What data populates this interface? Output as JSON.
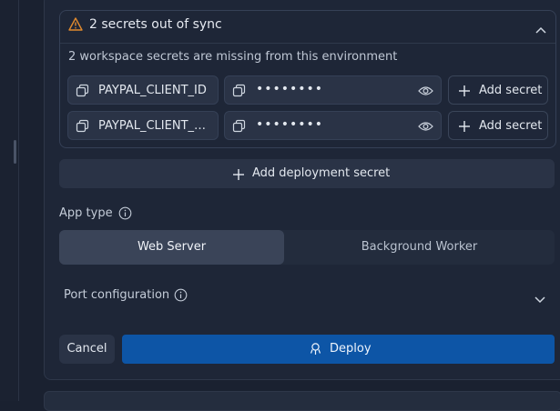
{
  "sync_warning": {
    "title": "2 secrets out of sync",
    "description": "2 workspace secrets are missing from this environment",
    "rows": [
      {
        "name": "PAYPAL_CLIENT_ID",
        "masked_value": "••••••••",
        "add_label": "Add secret"
      },
      {
        "name": "PAYPAL_CLIENT_…",
        "masked_value": "••••••••",
        "add_label": "Add secret"
      }
    ]
  },
  "add_deployment_secret_label": "Add deployment secret",
  "app_type": {
    "label": "App type",
    "options": [
      "Web Server",
      "Background Worker"
    ],
    "selected": "Web Server"
  },
  "port_configuration": {
    "label": "Port configuration"
  },
  "actions": {
    "cancel": "Cancel",
    "deploy": "Deploy"
  },
  "colors": {
    "accent": "#0d55a6",
    "warning": "#e08a2e",
    "background": "#1a2130"
  }
}
